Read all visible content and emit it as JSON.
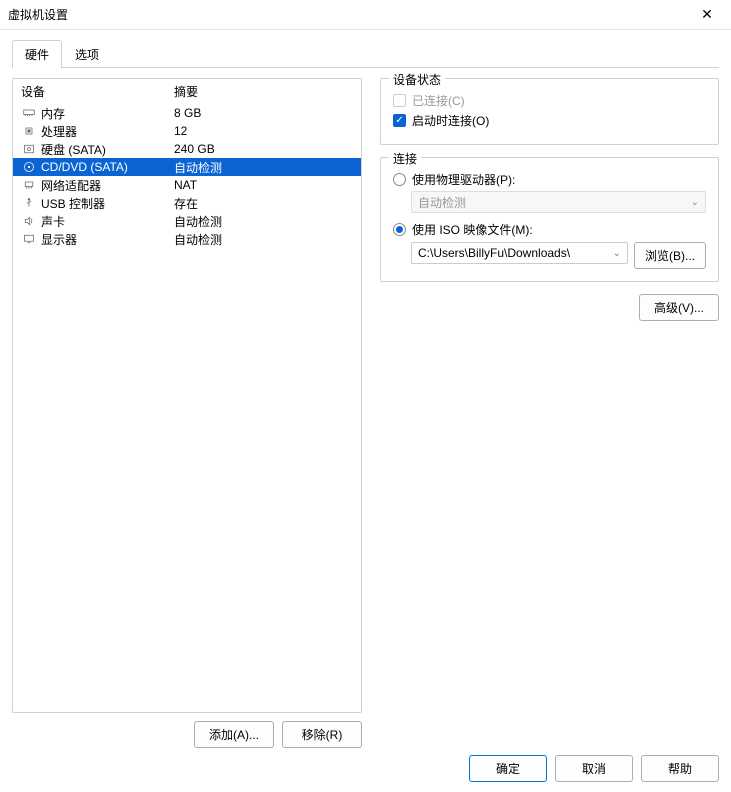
{
  "window_title": "虚拟机设置",
  "tabs": [
    "硬件",
    "选项"
  ],
  "list_headers": {
    "device": "设备",
    "summary": "摘要"
  },
  "devices": [
    {
      "key": "memory",
      "name": "内存",
      "summary": "8 GB"
    },
    {
      "key": "cpu",
      "name": "处理器",
      "summary": "12"
    },
    {
      "key": "disk",
      "name": "硬盘 (SATA)",
      "summary": "240 GB"
    },
    {
      "key": "cd",
      "name": "CD/DVD (SATA)",
      "summary": "自动检测"
    },
    {
      "key": "net",
      "name": "网络适配器",
      "summary": "NAT"
    },
    {
      "key": "usb",
      "name": "USB 控制器",
      "summary": "存在"
    },
    {
      "key": "sound",
      "name": "声卡",
      "summary": "自动检测"
    },
    {
      "key": "display",
      "name": "显示器",
      "summary": "自动检测"
    }
  ],
  "selected_device_index": 3,
  "left_buttons": {
    "add": "添加(A)...",
    "remove": "移除(R)"
  },
  "status_group": {
    "title": "设备状态",
    "connected": "已连接(C)",
    "connect_on_power": "启动时连接(O)"
  },
  "connection_group": {
    "title": "连接",
    "physical": "使用物理驱动器(P):",
    "auto_detect": "自动检测",
    "iso": "使用 ISO 映像文件(M):",
    "iso_path": "C:\\Users\\BillyFu\\Downloads\\",
    "browse": "浏览(B)..."
  },
  "advanced": "高级(V)...",
  "footer": {
    "ok": "确定",
    "cancel": "取消",
    "help": "帮助"
  }
}
